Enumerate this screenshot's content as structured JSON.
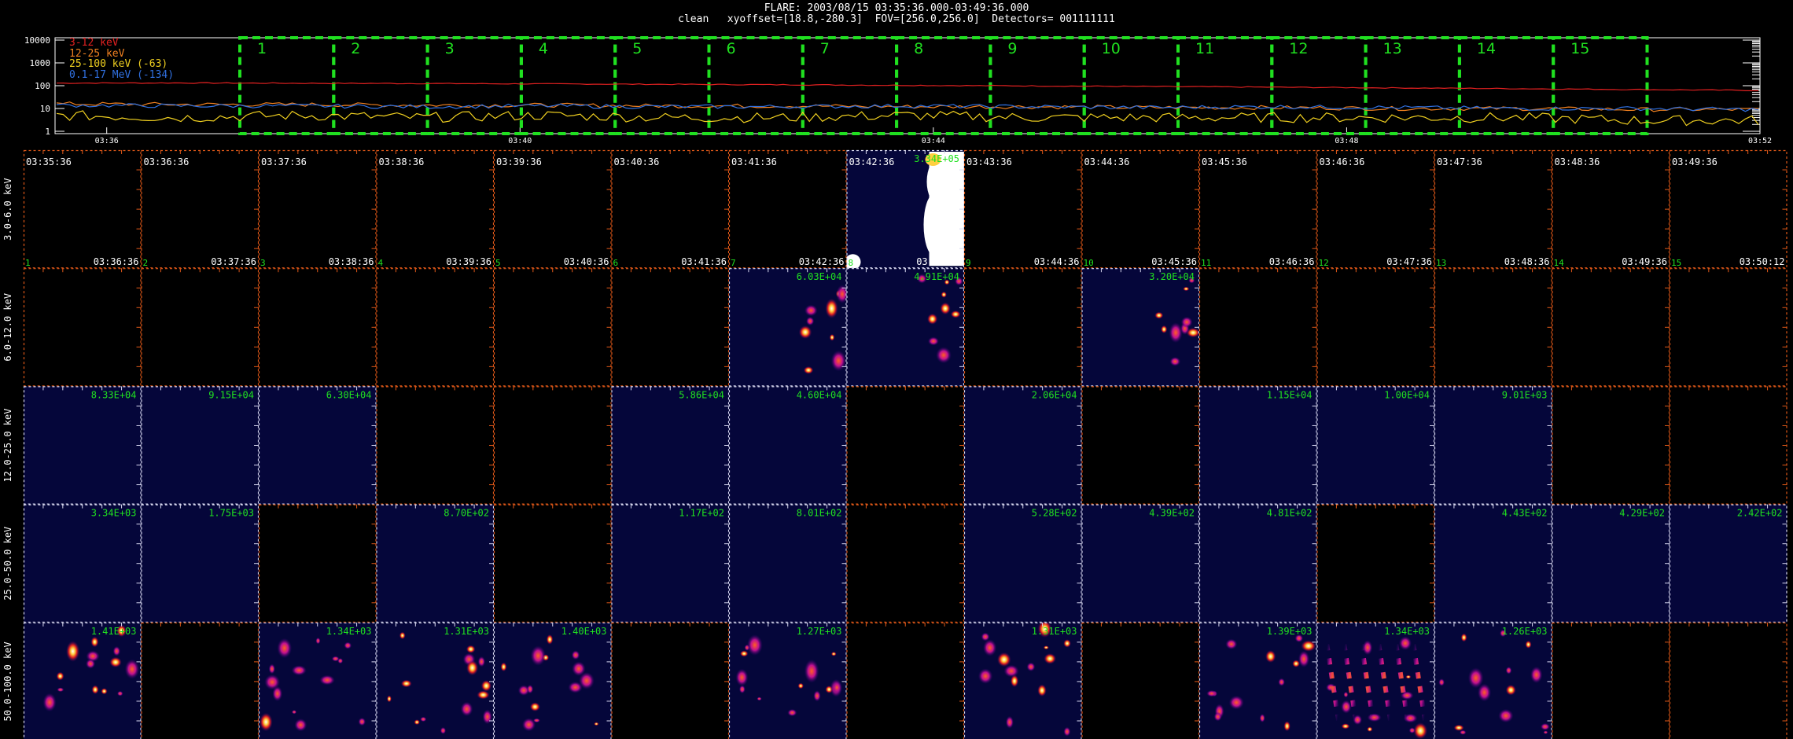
{
  "header": {
    "line1": "FLARE: 2003/08/15 03:35:36.000-03:49:36.000",
    "line2": "clean   xyoffset=[18.8,-280.3]  FOV=[256.0,256.0]  Detectors= 001111111"
  },
  "lightcurve": {
    "y_ticks": [
      "10000",
      "1000",
      "100",
      "10",
      "1"
    ],
    "x_ticks": [
      "03:36",
      "03:40",
      "03:44",
      "03:48",
      "03:52"
    ],
    "legend": [
      {
        "label": "3-12 keV",
        "color": "#e02020"
      },
      {
        "label": "12-25 keV",
        "color": "#f08020"
      },
      {
        "label": "25-100 keV (-63)",
        "color": "#f0d020"
      },
      {
        "label": "0.1-17 MeV (-134)",
        "color": "#3070e0"
      }
    ],
    "window_numbers": [
      "1",
      "2",
      "3",
      "4",
      "5",
      "6",
      "7",
      "8",
      "9",
      "10",
      "11",
      "12",
      "13",
      "14",
      "15"
    ]
  },
  "chart_data": {
    "type": "heatmap",
    "title": "FLARE: 2003/08/15 03:35:36.000-03:49:36.000",
    "rows": [
      "3.0-6.0 keV",
      "6.0-12.0 keV",
      "12.0-25.0 keV",
      "25.0-50.0 keV",
      "50.0-100.0 keV"
    ],
    "start_times": [
      "03:35:36",
      "03:36:36",
      "03:37:36",
      "03:38:36",
      "03:39:36",
      "03:40:36",
      "03:41:36",
      "03:42:36",
      "03:43:36",
      "03:44:36",
      "03:45:36",
      "03:46:36",
      "03:47:36",
      "03:48:36",
      "03:49:36"
    ],
    "end_times": [
      "03:36:36",
      "03:37:36",
      "03:38:36",
      "03:39:36",
      "03:40:36",
      "03:41:36",
      "03:42:36",
      "03:43:36",
      "03:44:36",
      "03:45:36",
      "03:46:36",
      "03:47:36",
      "03:48:36",
      "03:49:36",
      "03:50:12"
    ],
    "interval_numbers": [
      "1",
      "2",
      "3",
      "4",
      "5",
      "6",
      "7",
      "8",
      "9",
      "10",
      "11",
      "12",
      "13",
      "14",
      "15"
    ],
    "peak_values": [
      [
        "",
        "",
        "",
        "",
        "",
        "",
        "",
        "3.34E+05",
        "",
        "",
        "",
        "",
        "",
        "",
        ""
      ],
      [
        "",
        "",
        "",
        "",
        "",
        "",
        "6.03E+04",
        "4.91E+04",
        "",
        "3.20E+04",
        "",
        "",
        "",
        "",
        ""
      ],
      [
        "8.33E+04",
        "9.15E+04",
        "6.30E+04",
        "",
        "",
        "5.86E+04",
        "4.60E+04",
        "",
        "2.06E+04",
        "",
        "1.15E+04",
        "1.00E+04",
        "9.01E+03",
        "",
        ""
      ],
      [
        "3.34E+03",
        "1.75E+03",
        "",
        "8.70E+02",
        "",
        "1.17E+02",
        "8.01E+02",
        "",
        "5.28E+02",
        "4.39E+02",
        "4.81E+02",
        "",
        "4.43E+02",
        "4.29E+02",
        "2.42E+02"
      ],
      [
        "1.41E+03",
        "",
        "1.34E+03",
        "1.31E+03",
        "1.40E+03",
        "",
        "1.27E+03",
        "",
        "1.31E+03",
        "",
        "1.39E+03",
        "1.34E+03",
        "1.26E+03",
        "",
        ""
      ]
    ],
    "series": [
      {
        "name": "3-12 keV",
        "values": [
          130,
          132,
          128,
          125,
          120,
          115,
          110,
          104,
          98,
          92,
          86,
          80,
          74,
          68,
          62
        ]
      },
      {
        "name": "12-25 keV",
        "values": [
          16,
          15,
          15,
          14,
          14,
          13,
          13,
          12,
          12,
          11,
          11,
          10,
          10,
          9,
          9
        ]
      },
      {
        "name": "25-100 keV (-63)",
        "values": [
          5,
          4,
          5,
          4,
          5,
          4,
          4,
          5,
          4,
          4,
          4,
          4,
          4,
          3,
          3
        ]
      },
      {
        "name": "0.1-17 MeV (-134)",
        "values": [
          14,
          13,
          13,
          12,
          13,
          12,
          12,
          13,
          12,
          11,
          12,
          11,
          10,
          10,
          9
        ]
      }
    ],
    "ylim": [
      1,
      10000
    ],
    "y_scale": "log"
  }
}
